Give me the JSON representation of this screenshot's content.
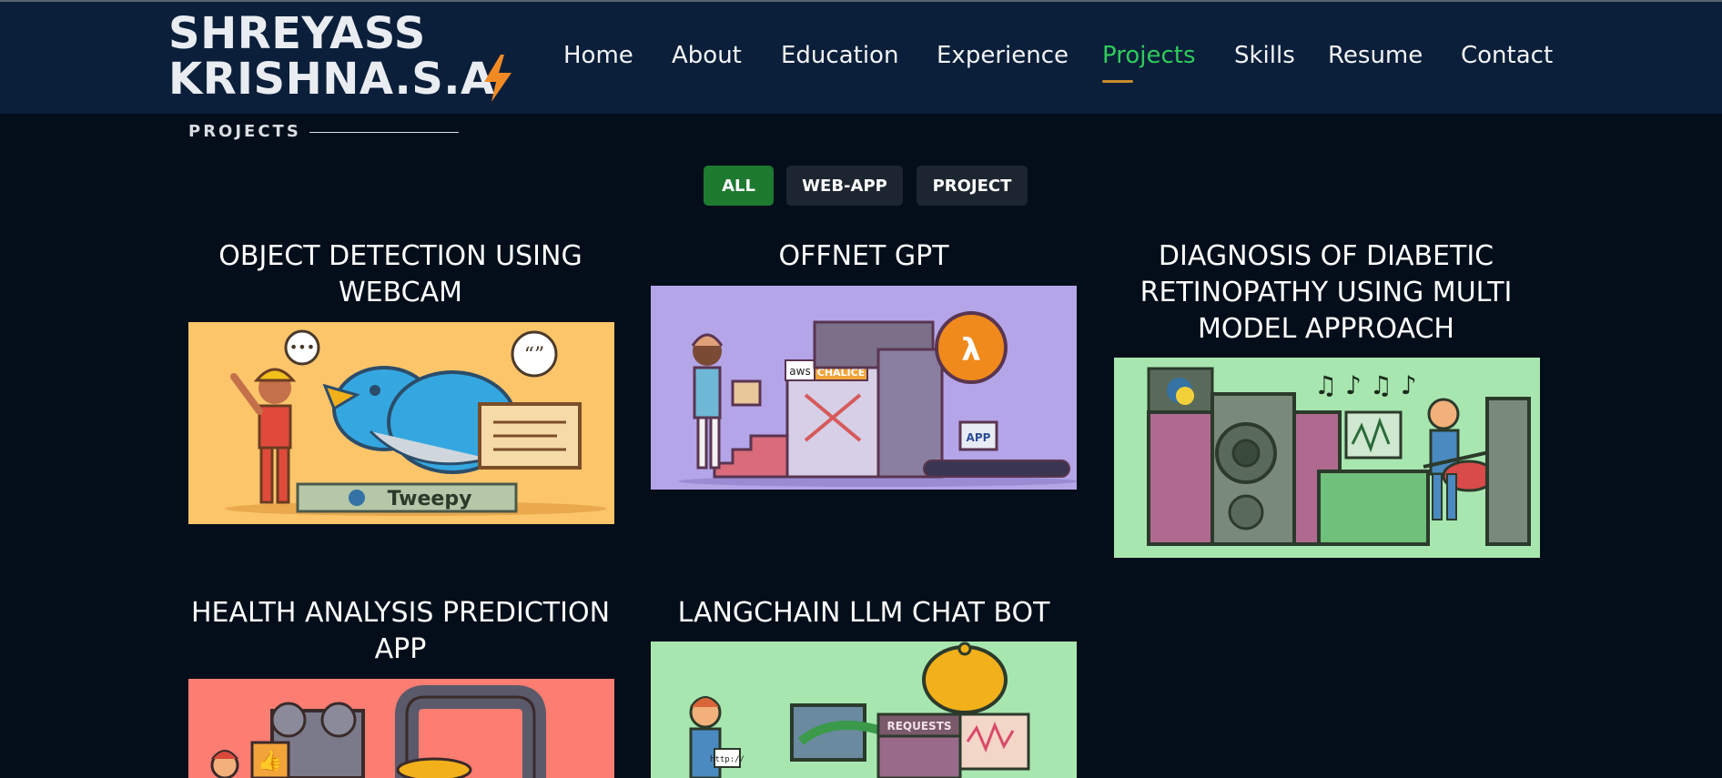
{
  "header": {
    "logo_line1": "SHREYASS",
    "logo_line2": "KRISHNA.S.A",
    "bolt_color": "#f28a24",
    "nav": [
      {
        "label": "Home"
      },
      {
        "label": "About"
      },
      {
        "label": "Education"
      },
      {
        "label": "Experience"
      },
      {
        "label": "Projects",
        "active": true
      },
      {
        "label": "Skills"
      },
      {
        "label": "Resume"
      },
      {
        "label": "Contact"
      }
    ],
    "active_color": "#2ecc5b"
  },
  "section": {
    "label": "PROJECTS"
  },
  "filters": [
    {
      "label": "ALL",
      "active": true
    },
    {
      "label": "WEB-APP"
    },
    {
      "label": "PROJECT"
    }
  ],
  "projects": [
    {
      "title": "OBJECT DETECTION USING WEBCAM",
      "image_bg": "#fcc56a",
      "image_text": "Tweepy"
    },
    {
      "title": "OFFNET GPT",
      "image_bg": "#b3a5e8",
      "image_text_1": "aws",
      "image_text_2": "CHALICE",
      "image_text_3": "APP",
      "image_text_4": "λ"
    },
    {
      "title": "DIAGNOSIS OF DIABETIC RETINOPATHY USING MULTI MODEL APPROACH",
      "image_bg": "#a8e6b0"
    },
    {
      "title": "HEALTH ANALYSIS PREDICTION APP",
      "image_bg": "#fc7d72"
    },
    {
      "title": "LANGCHAIN LLM CHAT BOT",
      "image_bg": "#a8e6b0",
      "image_text": "REQUESTS",
      "image_text_2": "http://"
    }
  ]
}
